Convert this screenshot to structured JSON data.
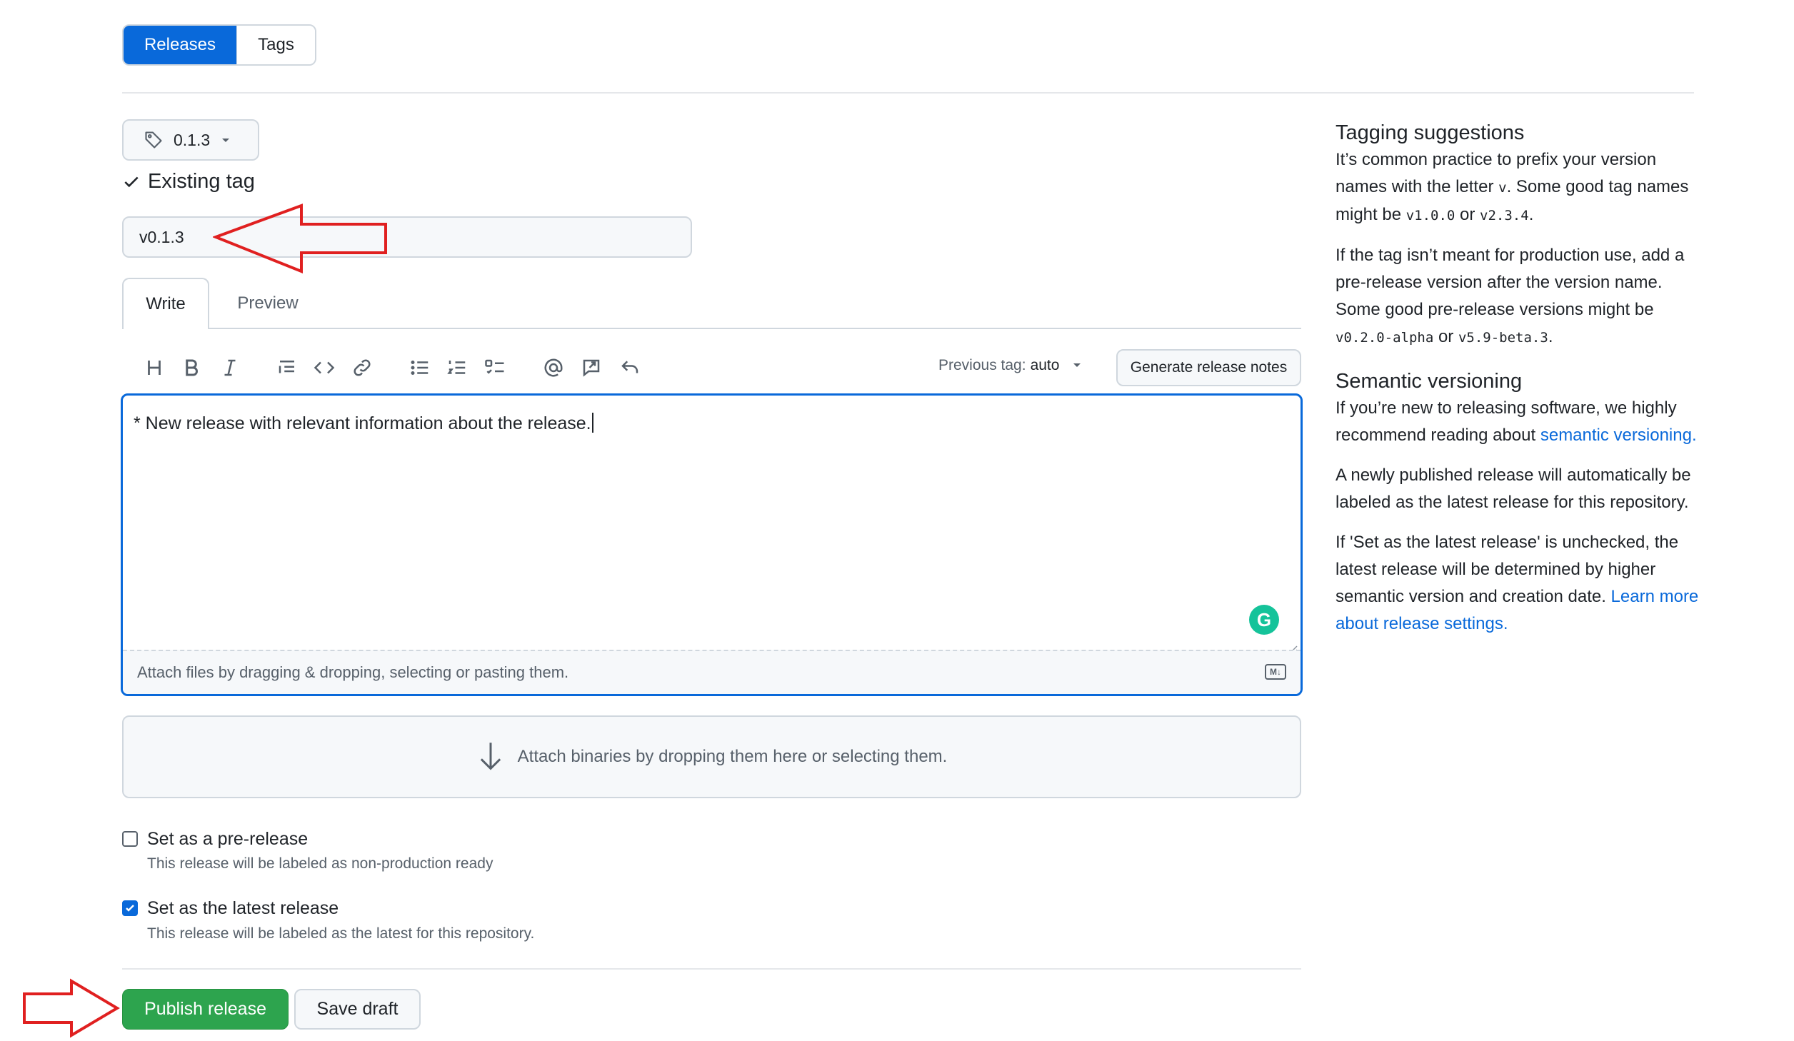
{
  "nav": {
    "releases": "Releases",
    "tags": "Tags"
  },
  "tag": {
    "selected": "0.1.3",
    "status": "Existing tag",
    "title_value": "v0.1.3"
  },
  "tabs": {
    "write": "Write",
    "preview": "Preview"
  },
  "toolbar": {
    "previous_tag_label": "Previous tag:",
    "previous_tag_value": "auto",
    "generate": "Generate release notes"
  },
  "editor": {
    "content": "* New release with relevant information about the release.",
    "attach_hint": "Attach files by dragging & dropping, selecting or pasting them."
  },
  "binaries": {
    "text": "Attach binaries by dropping them here or selecting them."
  },
  "prerelease": {
    "label": "Set as a pre-release",
    "sub": "This release will be labeled as non-production ready",
    "checked": false
  },
  "latest": {
    "label": "Set as the latest release",
    "sub": "This release will be labeled as the latest for this repository.",
    "checked": true
  },
  "actions": {
    "publish": "Publish release",
    "draft": "Save draft"
  },
  "sidebar": {
    "tagging_title": "Tagging suggestions",
    "tagging_p1_a": "It’s common practice to prefix your version names with the letter ",
    "tagging_p1_code1": "v",
    "tagging_p1_b": ". Some good tag names might be ",
    "tagging_p1_code2": "v1.0.0",
    "tagging_p1_c": " or ",
    "tagging_p1_code3": "v2.3.4",
    "tagging_p1_d": ".",
    "tagging_p2_a": "If the tag isn’t meant for production use, add a pre-release version after the version name. Some good pre-release versions might be ",
    "tagging_p2_code1": "v0.2.0-alpha",
    "tagging_p2_b": " or ",
    "tagging_p2_code2": "v5.9-beta.3",
    "tagging_p2_c": ".",
    "semver_title": "Semantic versioning",
    "semver_p1_a": "If you’re new to releasing software, we highly recommend reading about ",
    "semver_p1_link": "semantic versioning.",
    "semver_p2": "A newly published release will automatically be labeled as the latest release for this repository.",
    "semver_p3_a": "If 'Set as the latest release' is unchecked, the latest release will be determined by higher semantic version and creation date. ",
    "semver_p3_link": "Learn more about release settings."
  },
  "colors": {
    "accent": "#0969da",
    "publish": "#2da44e",
    "annotation": "#e02020"
  }
}
